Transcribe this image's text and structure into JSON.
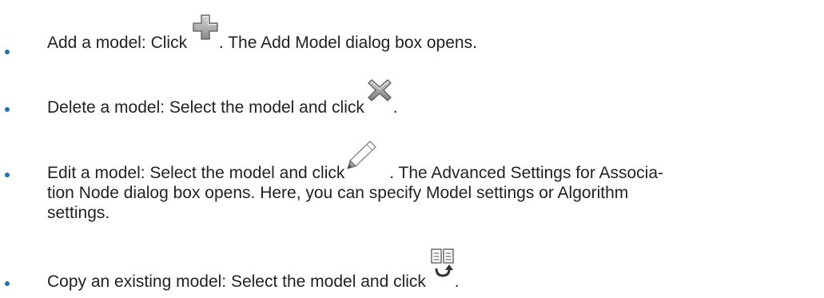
{
  "bullet_color": "#1f6fb5",
  "items": [
    {
      "before": "Add a model: Click ",
      "icon": "add-plus-icon",
      "after": ". The Add Model dialog box opens."
    },
    {
      "before": "Delete a model: Select the model and click ",
      "icon": "delete-x-icon",
      "after": "."
    },
    {
      "before": "Edit a model: Select the model and click ",
      "icon": "pencil-edit-icon",
      "after": ". The Advanced Settings for Associa-",
      "line2": "tion Node dialog box opens. Here, you can specify Model settings or Algorithm",
      "line3": "settings."
    },
    {
      "before": "Copy an existing model: Select the model and click ",
      "icon": "copy-model-icon",
      "after": "."
    }
  ]
}
